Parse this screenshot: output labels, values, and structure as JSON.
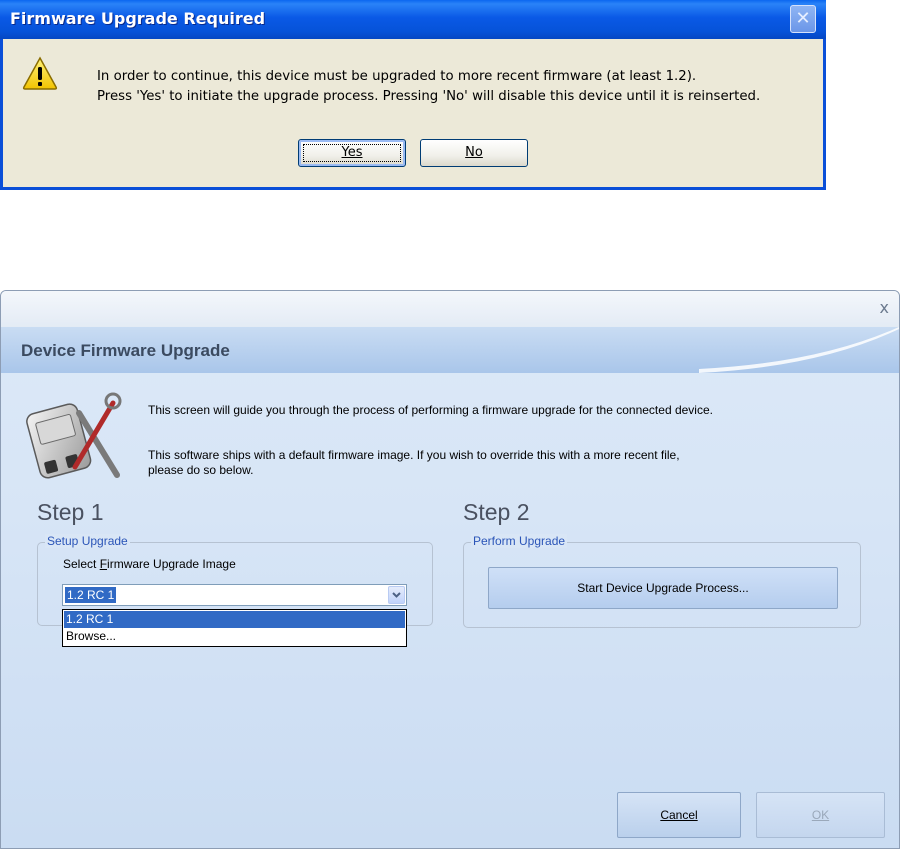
{
  "error_dialog": {
    "title": "Firmware Upgrade Required",
    "message_line1": "In order to continue, this device must be upgraded to more recent firmware (at least 1.2).",
    "message_line2": "Press 'Yes' to initiate the upgrade process.  Pressing 'No' will disable this device until it is reinserted.",
    "yes_label": "Yes",
    "no_label": "No",
    "icon": "warning-icon"
  },
  "upgrade_window": {
    "title": "Device Firmware Upgrade",
    "intro_line1": "This screen will guide you through the process of performing a firmware upgrade for the connected device.",
    "intro_line2": "This software ships with a default firmware image.  If you wish to override this with a more recent file,",
    "intro_line3": "please do so below.",
    "step1": {
      "heading": "Step 1",
      "group_label": "Setup Upgrade",
      "select_label": "Select Firmware Upgrade Image",
      "selected_value": "1.2 RC 1",
      "options": [
        "1.2 RC 1",
        "Browse..."
      ]
    },
    "step2": {
      "heading": "Step 2",
      "group_label": "Perform Upgrade",
      "button_label": "Start Device Upgrade Process..."
    },
    "cancel_label": "Cancel",
    "ok_label": "OK",
    "close_label": "x"
  },
  "colors": {
    "xp_title_blue": "#0653d9",
    "xp_dialog_bg": "#ece9d8",
    "selection_blue": "#316ac5",
    "window_bg": "#d7e5f6"
  }
}
